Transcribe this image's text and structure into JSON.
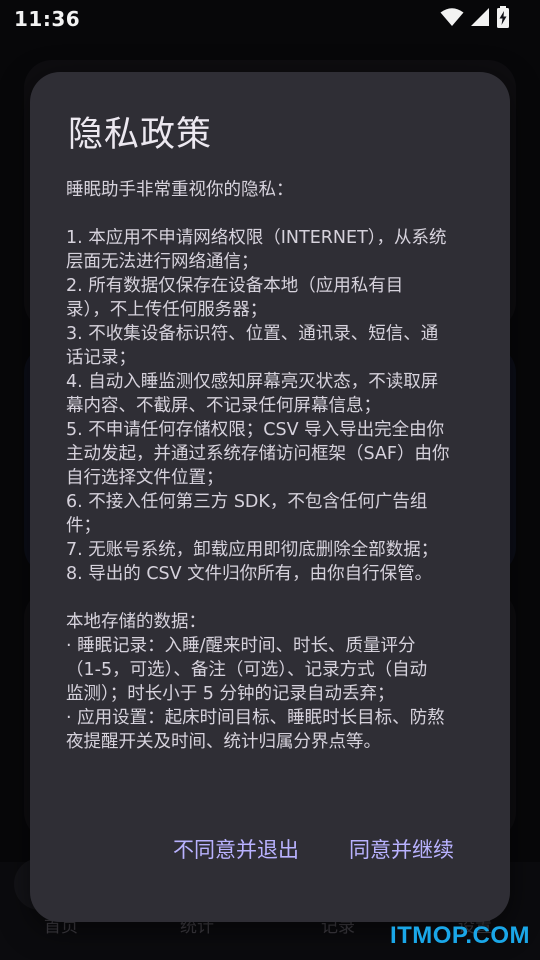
{
  "status_bar": {
    "time": "11:36",
    "icons": [
      "wifi-icon",
      "signal-icon",
      "battery-charging-icon"
    ]
  },
  "background": {
    "nav_items": [
      "首页",
      "统计",
      "记录",
      "设置"
    ]
  },
  "dialog": {
    "title": "隐私政策",
    "lines": [
      "睡眠助手非常重视你的隐私：",
      "",
      "1. 本应用不申请网络权限（INTERNET），从系统",
      "层面无法进行网络通信；",
      "2. 所有数据仅保存在设备本地（应用私有目",
      "录），不上传任何服务器；",
      "3. 不收集设备标识符、位置、通讯录、短信、通",
      "话记录；",
      "4. 自动入睡监测仅感知屏幕亮灭状态，不读取屏",
      "幕内容、不截屏、不记录任何屏幕信息；",
      "5. 不申请任何存储权限；CSV 导入导出完全由你",
      "主动发起，并通过系统存储访问框架（SAF）由你",
      "自行选择文件位置；",
      "6. 不接入任何第三方 SDK，不包含任何广告组",
      "件；",
      "7. 无账号系统，卸载应用即彻底删除全部数据；",
      "8. 导出的 CSV 文件归你所有，由你自行保管。",
      "",
      "本地存储的数据：",
      "· 睡眠记录：入睡/醒来时间、时长、质量评分",
      "（1-5，可选）、备注（可选）、记录方式（自动",
      "监测）；时长小于 5 分钟的记录自动丢弃；",
      "· 应用设置：起床时间目标、睡眠时长目标、防熬",
      "夜提醒开关及时间、统计归属分界点等。"
    ],
    "decline_label": "不同意并退出",
    "accept_label": "同意并继续"
  },
  "watermark": "ITMOP.COM",
  "colors": {
    "dialog_bg": "#2f2e35",
    "accent": "#b9b2ff",
    "watermark": "#1aa7e8"
  }
}
